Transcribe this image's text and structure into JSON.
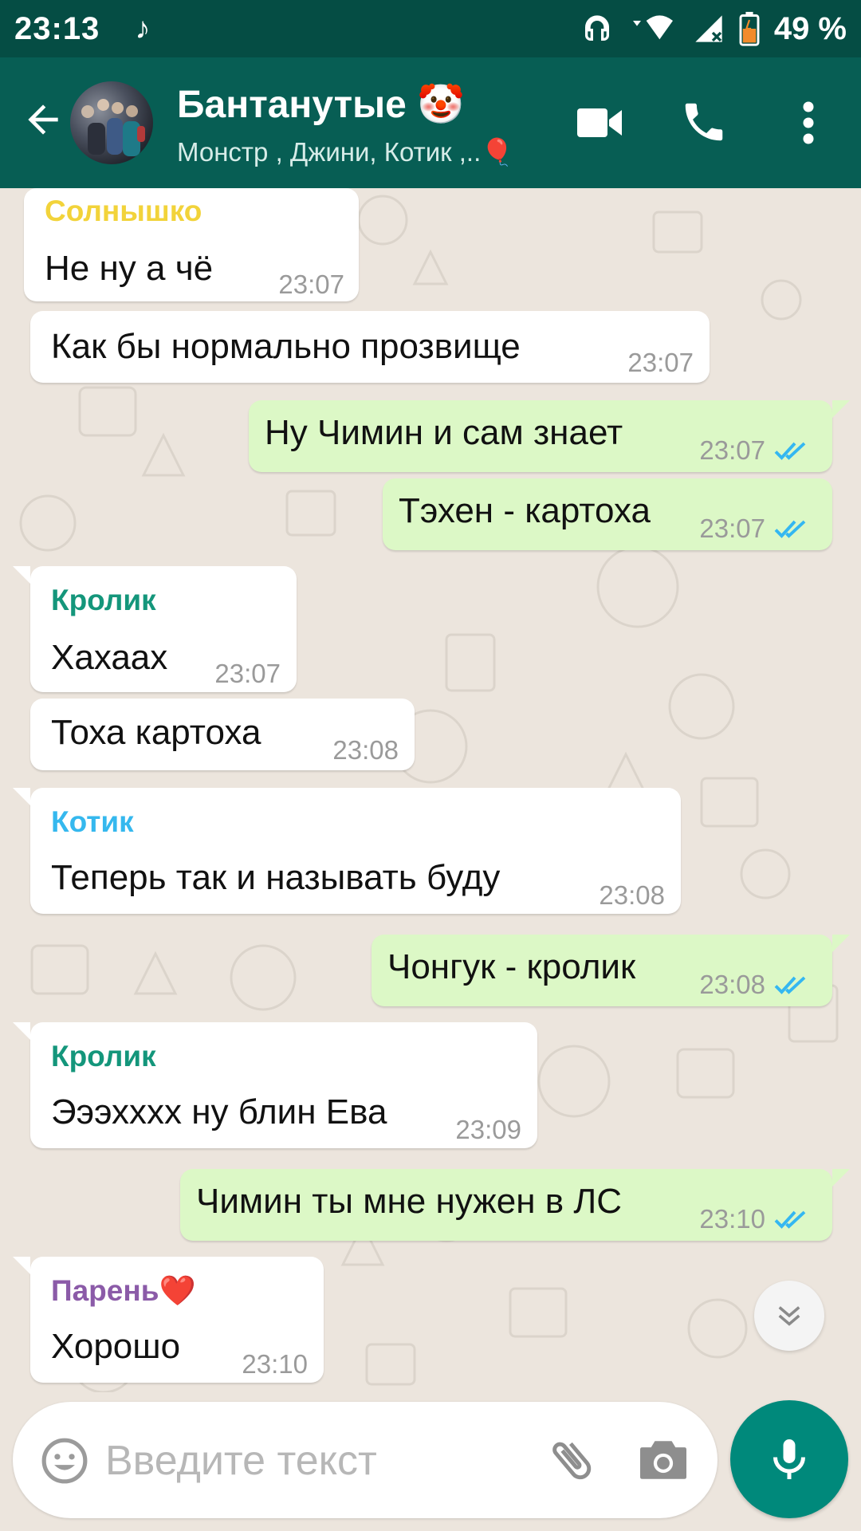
{
  "status_bar": {
    "time": "23:13",
    "note_glyph": "♪",
    "battery_percent": "49 %"
  },
  "header": {
    "title": "Бантанутые 🤡",
    "subtitle": "Монстр , Джини, Котик ,..🎈"
  },
  "messages": [
    {
      "direction": "in",
      "sender": "Солнышко",
      "sender_color": "#F2D33A",
      "text": "Не ну а чё",
      "time": "23:07"
    },
    {
      "direction": "in",
      "sender": "",
      "text": "Как бы нормально прозвище",
      "time": "23:07"
    },
    {
      "direction": "out",
      "text": "Ну Чимин и сам знает",
      "time": "23:07",
      "read": true
    },
    {
      "direction": "out",
      "text": "Тэхен - картоха",
      "time": "23:07",
      "read": true
    },
    {
      "direction": "in",
      "sender": "Кролик",
      "sender_color": "#14967B",
      "text": "Хахаах",
      "time": "23:07"
    },
    {
      "direction": "in",
      "sender": "",
      "text": "Тоха картоха",
      "time": "23:08"
    },
    {
      "direction": "in",
      "sender": "Котик",
      "sender_color": "#35B8EE",
      "text": "Теперь так и называть буду",
      "time": "23:08"
    },
    {
      "direction": "out",
      "text": "Чонгук - кролик",
      "time": "23:08",
      "read": true
    },
    {
      "direction": "in",
      "sender": "Кролик",
      "sender_color": "#14967B",
      "text": "Эээхххх ну блин Ева",
      "time": "23:09"
    },
    {
      "direction": "out",
      "text": "Чимин ты мне нужен в ЛС",
      "time": "23:10",
      "read": true
    },
    {
      "direction": "in",
      "sender": "Парень❤️",
      "sender_color": "#8B5BA8",
      "text": "Хорошо",
      "time": "23:10"
    }
  ],
  "input": {
    "placeholder": "Введите текст"
  },
  "colors": {
    "header": "#075E54",
    "status_bar": "#054D44",
    "outgoing_bubble": "#DCF8C6",
    "incoming_bubble": "#FFFFFF",
    "read_ticks": "#34B7F1",
    "mic_button": "#00897B",
    "chat_background": "#ECE5DD"
  },
  "icons": [
    "back-arrow-icon",
    "video-call-icon",
    "phone-icon",
    "more-vert-icon",
    "emoji-icon",
    "attach-icon",
    "camera-icon",
    "mic-icon",
    "double-chevron-down-icon",
    "headphones-icon",
    "wifi-icon",
    "signal-icon",
    "battery-icon"
  ]
}
